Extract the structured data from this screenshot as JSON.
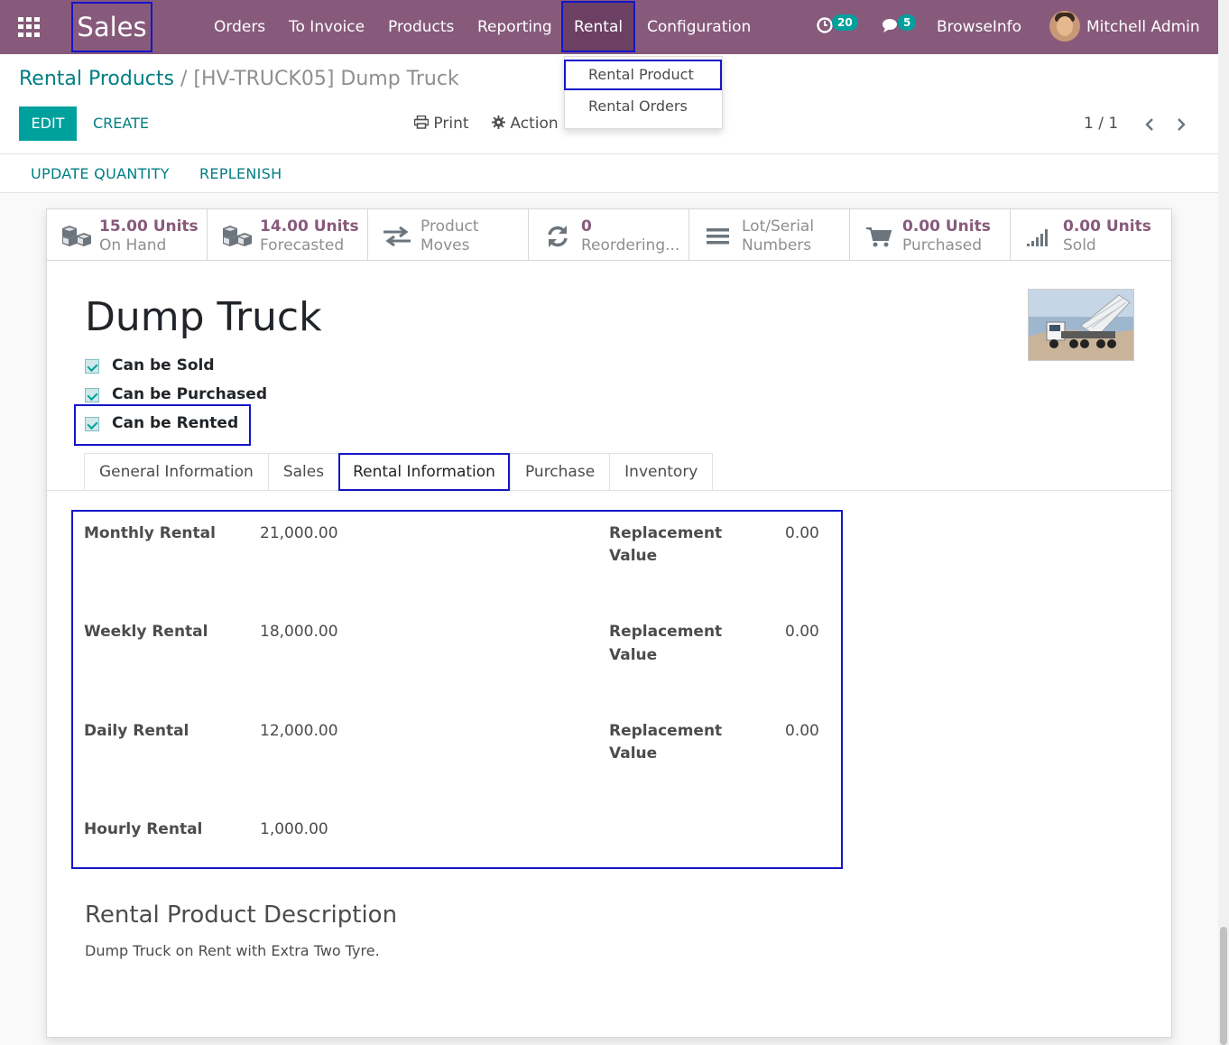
{
  "navbar": {
    "brand": "Sales",
    "menu": [
      "Orders",
      "To Invoice",
      "Products",
      "Reporting",
      "Rental",
      "Configuration"
    ],
    "activity_count": "20",
    "messages_count": "5",
    "company": "BrowseInfo",
    "user": "Mitchell Admin"
  },
  "dropdown": {
    "items": [
      "Rental Product",
      "Rental Orders"
    ]
  },
  "breadcrumb": {
    "parent": "Rental Products",
    "separator": "/",
    "current": "[HV-TRUCK05] Dump Truck"
  },
  "control": {
    "edit": "EDIT",
    "create": "CREATE",
    "print": "Print",
    "action": "Action",
    "pager": "1 / 1"
  },
  "statusbar": {
    "update_quantity": "UPDATE QUANTITY",
    "replenish": "REPLENISH"
  },
  "smart_buttons": [
    {
      "value": "15.00 Units",
      "label": "On Hand",
      "icon": "cubes-icon"
    },
    {
      "value": "14.00 Units",
      "label": "Forecasted",
      "icon": "cubes-icon"
    },
    {
      "value": "Product",
      "label": "Moves",
      "icon": "exchange-icon"
    },
    {
      "value": "0",
      "label": "Reordering...",
      "icon": "refresh-icon"
    },
    {
      "value": "Lot/Serial",
      "label": "Numbers",
      "icon": "bars-icon"
    },
    {
      "value": "0.00 Units",
      "label": "Purchased",
      "icon": "cart-icon"
    },
    {
      "value": "0.00 Units",
      "label": "Sold",
      "icon": "signal-icon"
    }
  ],
  "product": {
    "name": "Dump Truck",
    "can_be_sold": "Can be Sold",
    "can_be_purchased": "Can be Purchased",
    "can_be_rented": "Can be Rented"
  },
  "tabs": [
    "General Information",
    "Sales",
    "Rental Information",
    "Purchase",
    "Inventory"
  ],
  "rental": {
    "rows": [
      {
        "label": "Monthly Rental",
        "value": "21,000.00",
        "rep_label_1": "Replacement",
        "rep_label_2": "Value",
        "rep_value": "0.00"
      },
      {
        "label": "Weekly Rental",
        "value": "18,000.00",
        "rep_label_1": "Replacement",
        "rep_label_2": "Value",
        "rep_value": "0.00"
      },
      {
        "label": "Daily Rental",
        "value": "12,000.00",
        "rep_label_1": "Replacement",
        "rep_label_2": "Value",
        "rep_value": "0.00"
      },
      {
        "label": "Hourly Rental",
        "value": "1,000.00"
      }
    ]
  },
  "description": {
    "heading": "Rental Product Description",
    "text": "Dump Truck on Rent with Extra Two Tyre."
  },
  "colors": {
    "navbar": "#875a7b",
    "accent": "#00a09d",
    "link": "#017e84",
    "highlight": "#1515c8"
  }
}
